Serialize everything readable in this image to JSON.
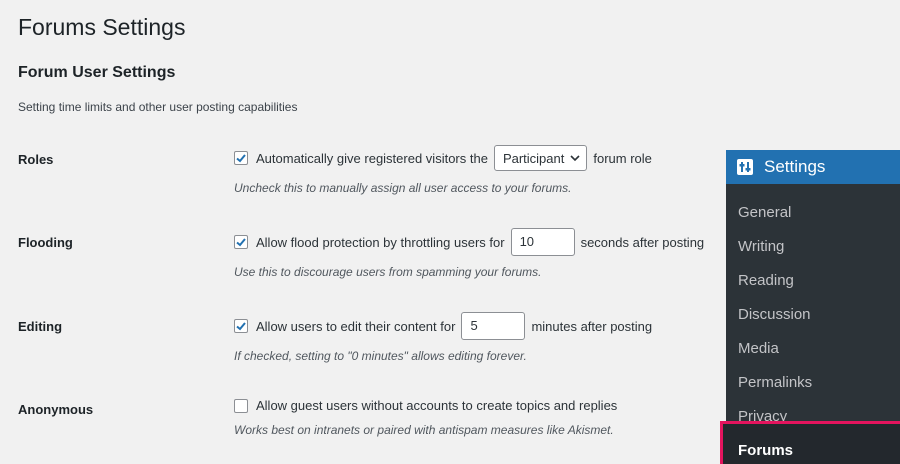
{
  "page": {
    "title": "Forums Settings",
    "section_title": "Forum User Settings",
    "section_desc": "Setting time limits and other user posting capabilities"
  },
  "rows": {
    "roles": {
      "label": "Roles",
      "checked": true,
      "text_before": "Automatically give registered visitors the",
      "select_value": "Participant",
      "text_after": "forum role",
      "desc": "Uncheck this to manually assign all user access to your forums."
    },
    "flooding": {
      "label": "Flooding",
      "checked": true,
      "text_before": "Allow flood protection by throttling users for",
      "input_value": "10",
      "text_after": "seconds after posting",
      "desc": "Use this to discourage users from spamming your forums."
    },
    "editing": {
      "label": "Editing",
      "checked": true,
      "text_before": "Allow users to edit their content for",
      "input_value": "5",
      "text_after": "minutes after posting",
      "desc": "If checked, setting to \"0 minutes\" allows editing forever."
    },
    "anonymous": {
      "label": "Anonymous",
      "checked": false,
      "text_before": "Allow guest users without accounts to create topics and replies",
      "desc": "Works best on intranets or paired with antispam measures like Akismet."
    }
  },
  "menu": {
    "header": "Settings",
    "header_icon": "settings-sliders-icon",
    "items": [
      "General",
      "Writing",
      "Reading",
      "Discussion",
      "Media",
      "Permalinks",
      "Privacy",
      "Forums"
    ],
    "active": "Forums"
  },
  "colors": {
    "accent": "#2271b1",
    "menu_bg": "#2c3338",
    "highlight": "#e4145e",
    "check": "#2271b1"
  }
}
